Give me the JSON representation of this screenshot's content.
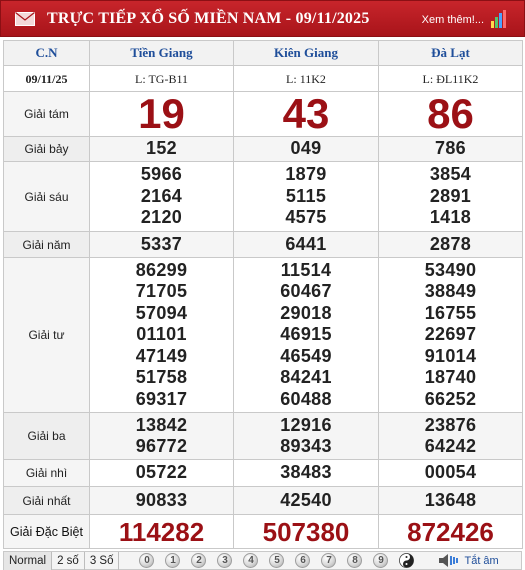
{
  "header": {
    "title": "TRỰC TIẾP XỔ SỐ MIỀN NAM - 09/11/2025",
    "more_link": "Xem thêm!..."
  },
  "table": {
    "weekday": "C.N",
    "date": "09/11/25",
    "provinces": [
      "Tiền Giang",
      "Kiên Giang",
      "Đà Lạt"
    ],
    "codes": [
      "L: TG-B11",
      "L: 11K2",
      "L: ĐL11K2"
    ],
    "prizes": [
      {
        "label": "Giải tám",
        "values": [
          [
            "19"
          ],
          [
            "43"
          ],
          [
            "86"
          ]
        ]
      },
      {
        "label": "Giải bảy",
        "values": [
          [
            "152"
          ],
          [
            "049"
          ],
          [
            "786"
          ]
        ]
      },
      {
        "label": "Giải sáu",
        "values": [
          [
            "5966",
            "2164",
            "2120"
          ],
          [
            "1879",
            "5115",
            "4575"
          ],
          [
            "3854",
            "2891",
            "1418"
          ]
        ]
      },
      {
        "label": "Giải năm",
        "values": [
          [
            "5337"
          ],
          [
            "6441"
          ],
          [
            "2878"
          ]
        ]
      },
      {
        "label": "Giải tư",
        "values": [
          [
            "86299",
            "71705",
            "57094",
            "01101",
            "47149",
            "51758",
            "69317"
          ],
          [
            "11514",
            "60467",
            "29018",
            "46915",
            "46549",
            "84241",
            "60488"
          ],
          [
            "53490",
            "38849",
            "16755",
            "22697",
            "91014",
            "18740",
            "66252"
          ]
        ]
      },
      {
        "label": "Giải ba",
        "values": [
          [
            "13842",
            "96772"
          ],
          [
            "12916",
            "89343"
          ],
          [
            "23876",
            "64242"
          ]
        ]
      },
      {
        "label": "Giải nhì",
        "values": [
          [
            "05722"
          ],
          [
            "38483"
          ],
          [
            "00054"
          ]
        ]
      },
      {
        "label": "Giải nhất",
        "values": [
          [
            "90833"
          ],
          [
            "42540"
          ],
          [
            "13648"
          ]
        ]
      },
      {
        "label": "Giải Đặc Biệt",
        "values": [
          [
            "114282"
          ],
          [
            "507380"
          ],
          [
            "872426"
          ]
        ]
      }
    ]
  },
  "toolbar": {
    "modes": [
      "Normal",
      "2 số",
      "3 Số"
    ],
    "digits": [
      "0",
      "1",
      "2",
      "3",
      "4",
      "5",
      "6",
      "7",
      "8",
      "9"
    ],
    "all_label": "Tắt âm"
  },
  "colors": {
    "header_bg": "#b71c22",
    "province_text": "#1f4e9a",
    "prize_red": "#9b1015"
  }
}
